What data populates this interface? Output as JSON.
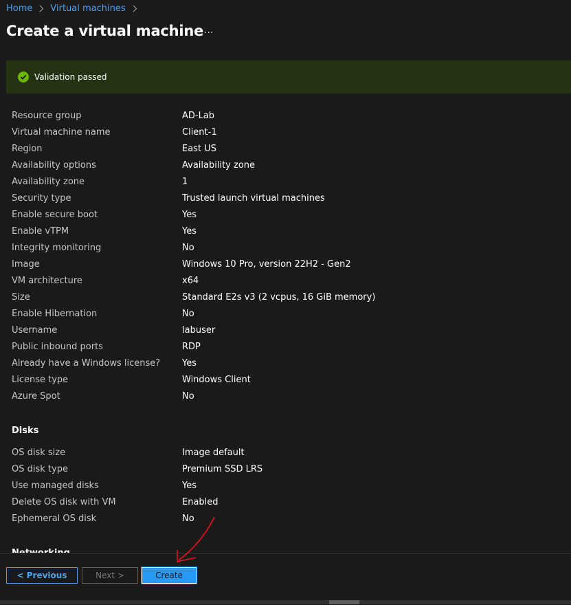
{
  "breadcrumb": {
    "home": "Home",
    "virtual_machines": "Virtual machines"
  },
  "page": {
    "title": "Create a virtual machine",
    "more": "···"
  },
  "validation": {
    "message": "Validation passed",
    "status_color": "#6bb700"
  },
  "basics": [
    {
      "label": "Resource group",
      "value": "AD-Lab"
    },
    {
      "label": "Virtual machine name",
      "value": "Client-1"
    },
    {
      "label": "Region",
      "value": "East US"
    },
    {
      "label": "Availability options",
      "value": "Availability zone"
    },
    {
      "label": "Availability zone",
      "value": "1"
    },
    {
      "label": "Security type",
      "value": "Trusted launch virtual machines"
    },
    {
      "label": "Enable secure boot",
      "value": "Yes"
    },
    {
      "label": "Enable vTPM",
      "value": "Yes"
    },
    {
      "label": "Integrity monitoring",
      "value": "No"
    },
    {
      "label": "Image",
      "value": "Windows 10 Pro, version 22H2 - Gen2"
    },
    {
      "label": "VM architecture",
      "value": "x64"
    },
    {
      "label": "Size",
      "value": "Standard E2s v3 (2 vcpus, 16 GiB memory)"
    },
    {
      "label": "Enable Hibernation",
      "value": "No"
    },
    {
      "label": "Username",
      "value": "labuser"
    },
    {
      "label": "Public inbound ports",
      "value": "RDP"
    },
    {
      "label": "Already have a Windows license?",
      "value": "Yes"
    },
    {
      "label": "License type",
      "value": "Windows Client"
    },
    {
      "label": "Azure Spot",
      "value": "No"
    }
  ],
  "disks": {
    "heading": "Disks",
    "rows": [
      {
        "label": "OS disk size",
        "value": "Image default"
      },
      {
        "label": "OS disk type",
        "value": "Premium SSD LRS"
      },
      {
        "label": "Use managed disks",
        "value": "Yes"
      },
      {
        "label": "Delete OS disk with VM",
        "value": "Enabled"
      },
      {
        "label": "Ephemeral OS disk",
        "value": "No"
      }
    ]
  },
  "networking": {
    "heading": "Networking"
  },
  "footer": {
    "previous": "< Previous",
    "next": "Next >",
    "create": "Create"
  },
  "colors": {
    "accent": "#2899f5",
    "link": "#4aa3f0",
    "annotation": "#e81123"
  }
}
